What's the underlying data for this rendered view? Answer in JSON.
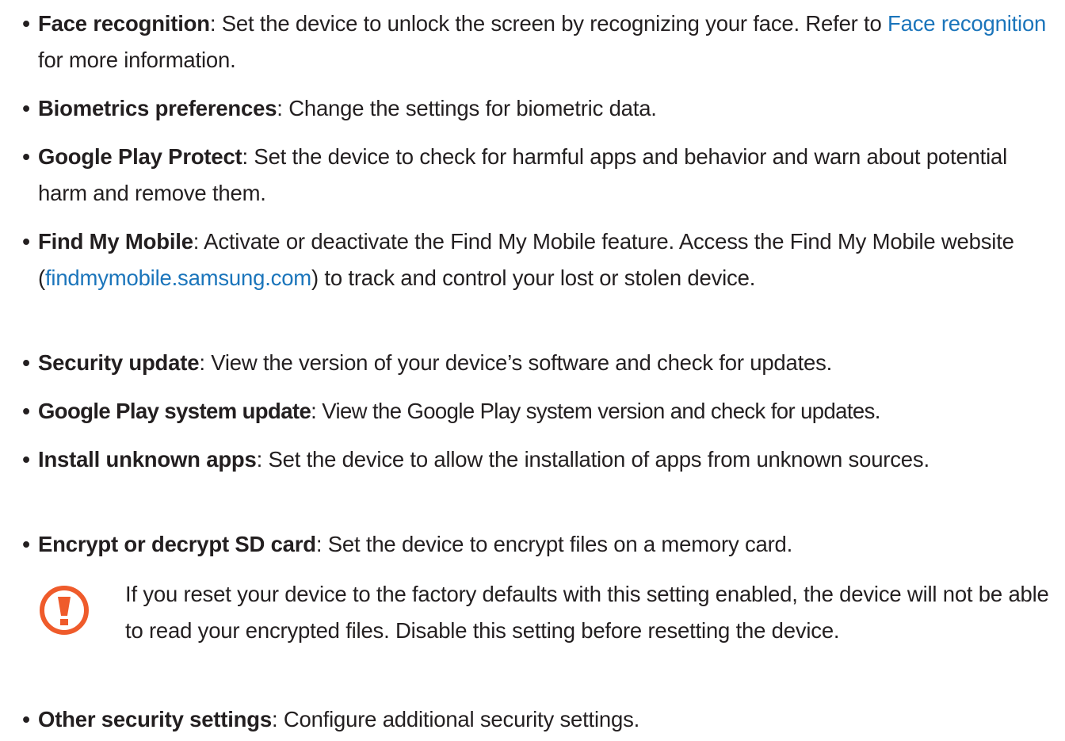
{
  "items": [
    {
      "bullet": "•",
      "term": "Face recognition",
      "sep": ": ",
      "text_before": "Set the device to unlock the screen by recognizing your face. Refer to ",
      "link": "Face recognition",
      "text_after": " for more information."
    },
    {
      "bullet": "•",
      "term": "Biometrics preferences",
      "sep": ": ",
      "text": "Change the settings for biometric data."
    },
    {
      "bullet": "•",
      "term": "Google Play Protect",
      "sep": ": ",
      "text": "Set the device to check for harmful apps and behavior and warn about potential harm and remove them."
    },
    {
      "bullet": "•",
      "term": "Find My Mobile",
      "sep": ": ",
      "text_before": "Activate or deactivate the Find My Mobile feature. Access the Find My Mobile website (",
      "link": "findmymobile.samsung.com",
      "text_after": ") to track and control your lost or stolen device."
    },
    {
      "bullet": "•",
      "term": "Security update",
      "sep": ": ",
      "text": "View the version of your device’s software and check for updates."
    },
    {
      "bullet": "•",
      "term": "Google Play system update",
      "sep": ": ",
      "text": "View the Google Play system version and check for updates."
    },
    {
      "bullet": "•",
      "term": "Install unknown apps",
      "sep": ": ",
      "text": "Set the device to allow the installation of apps from unknown sources."
    },
    {
      "bullet": "•",
      "term": "Encrypt or decrypt SD card",
      "sep": ": ",
      "text": "Set the device to encrypt files on a memory card."
    },
    {
      "bullet": "•",
      "term": "Other security settings",
      "sep": ": ",
      "text": "Configure additional security settings."
    }
  ],
  "caution": {
    "icon": "caution-icon",
    "text": "If you reset your device to the factory defaults with this setting enabled, the device will not be able to read your encrypted files. Disable this setting before resetting the device."
  },
  "colors": {
    "text": "#231f20",
    "link": "#1b75bb",
    "caution": "#ef5b2b"
  }
}
